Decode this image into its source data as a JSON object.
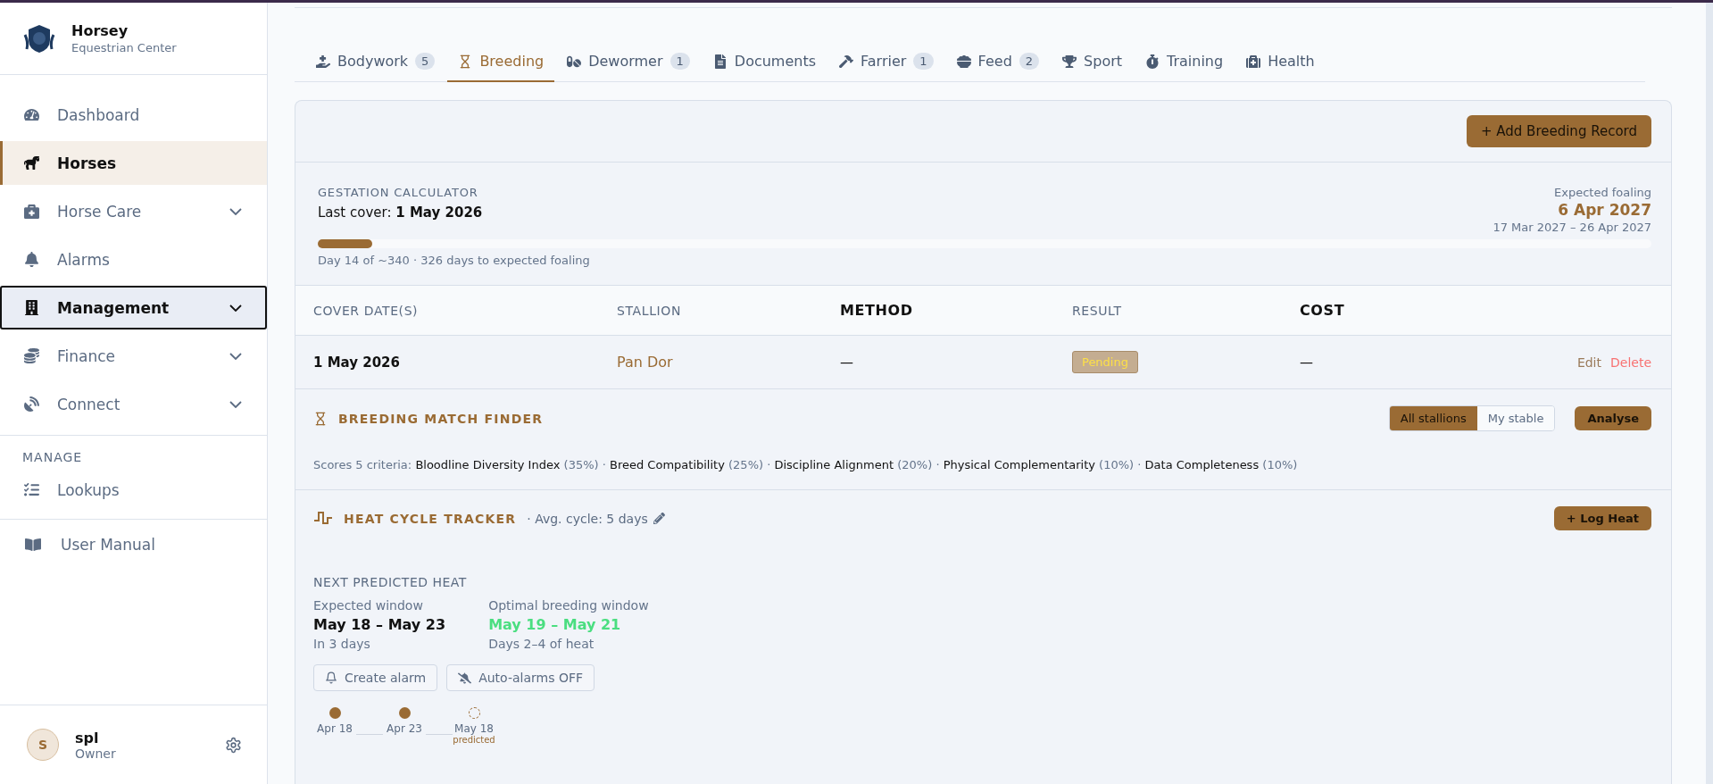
{
  "brand": {
    "name": "Horsey",
    "subtitle": "Equestrian Center"
  },
  "sidebar": {
    "items": [
      {
        "kind": "dashboard",
        "label": "Dashboard",
        "selected": false,
        "focused": false,
        "expandable": false
      },
      {
        "kind": "horses",
        "label": "Horses",
        "selected": true,
        "focused": false,
        "expandable": false
      },
      {
        "kind": "care",
        "label": "Horse Care",
        "selected": false,
        "focused": false,
        "expandable": true
      },
      {
        "kind": "alarms",
        "label": "Alarms",
        "selected": false,
        "focused": false,
        "expandable": false
      },
      {
        "kind": "management",
        "label": "Management",
        "selected": false,
        "focused": true,
        "expandable": true
      },
      {
        "kind": "finance",
        "label": "Finance",
        "selected": false,
        "focused": false,
        "expandable": true
      },
      {
        "kind": "connect",
        "label": "Connect",
        "selected": false,
        "focused": false,
        "expandable": true
      }
    ],
    "section_title": "MANAGE",
    "section_items": [
      {
        "kind": "lookups",
        "label": "Lookups",
        "selected": false
      }
    ],
    "manual": "User Manual",
    "user": {
      "initial": "S",
      "name": "spl",
      "role": "Owner"
    }
  },
  "tabs": [
    {
      "kind": "bodywork",
      "label": "Bodywork",
      "count": "5",
      "selected": false
    },
    {
      "kind": "breeding",
      "label": "Breeding",
      "selected": true
    },
    {
      "kind": "dewormer",
      "label": "Dewormer",
      "count": "1",
      "selected": false
    },
    {
      "kind": "documents",
      "label": "Documents",
      "selected": false
    },
    {
      "kind": "farrier",
      "label": "Farrier",
      "count": "1",
      "selected": false
    },
    {
      "kind": "feed",
      "label": "Feed",
      "count": "2",
      "selected": false
    },
    {
      "kind": "sport",
      "label": "Sport",
      "selected": false
    },
    {
      "kind": "training",
      "label": "Training",
      "selected": false
    },
    {
      "kind": "health",
      "label": "Health",
      "selected": false
    }
  ],
  "add_button": "+ Add Breeding Record",
  "gestation": {
    "title": "GESTATION CALCULATOR",
    "last_cover_label": "Last cover:",
    "last_cover": "1 May 2026",
    "expected_label": "Expected foaling",
    "expected_date": "6 Apr 2027",
    "expected_range": "17 Mar 2027 – 26 Apr 2027",
    "level": 0.041,
    "progress_text": "Day 14 of ~340 · 326 days to expected foaling"
  },
  "table": {
    "columns": [
      {
        "label": "COVER DATE(S)",
        "bold": false
      },
      {
        "label": "STALLION",
        "bold": false
      },
      {
        "label": "METHOD",
        "bold": true
      },
      {
        "label": "RESULT",
        "bold": false
      },
      {
        "label": "COST",
        "bold": true
      }
    ],
    "rows": [
      {
        "cover_date": "1 May 2026",
        "stallion": "Pan Dor",
        "method": "—",
        "result": "Pending",
        "cost": "—",
        "actions": [
          "Edit",
          "Delete"
        ]
      }
    ]
  },
  "match_finder": {
    "title": "BREEDING MATCH FINDER",
    "toggle": [
      {
        "label": "All stallions",
        "selected": true
      },
      {
        "label": "My stable",
        "selected": false
      }
    ],
    "analyse": "Analyse",
    "criteria_label": "Scores 5 criteria:",
    "separator": "·",
    "criteria": [
      {
        "name": "Bloodline Diversity Index",
        "weight": "(35%)"
      },
      {
        "name": "Breed Compatibility",
        "weight": "(25%)"
      },
      {
        "name": "Discipline Alignment",
        "weight": "(20%)"
      },
      {
        "name": "Physical Complementarity",
        "weight": "(10%)"
      },
      {
        "name": "Data Completeness",
        "weight": "(10%)"
      }
    ]
  },
  "heat_tracker": {
    "title": "HEAT CYCLE TRACKER",
    "avg_cycle": "· Avg. cycle: 5 days",
    "log_button": "+ Log Heat",
    "next_title": "NEXT PREDICTED HEAT",
    "windows": [
      {
        "kind": "expected",
        "label": "Expected window",
        "range": "May 18 – May 23",
        "note": "In 3 days"
      },
      {
        "kind": "optimal",
        "label": "Optimal breeding window",
        "range": "May 19 – May 21",
        "note": "Days 2–4 of heat"
      }
    ],
    "buttons": [
      {
        "kind": "alarm",
        "label": "Create alarm"
      },
      {
        "kind": "auto",
        "label": "Auto-alarms OFF"
      }
    ],
    "timeline": [
      {
        "kind": "past",
        "date": "Apr 18"
      },
      {
        "kind": "past",
        "date": "Apr 23"
      },
      {
        "kind": "predicted",
        "date": "May 18",
        "note": "predicted"
      }
    ]
  }
}
